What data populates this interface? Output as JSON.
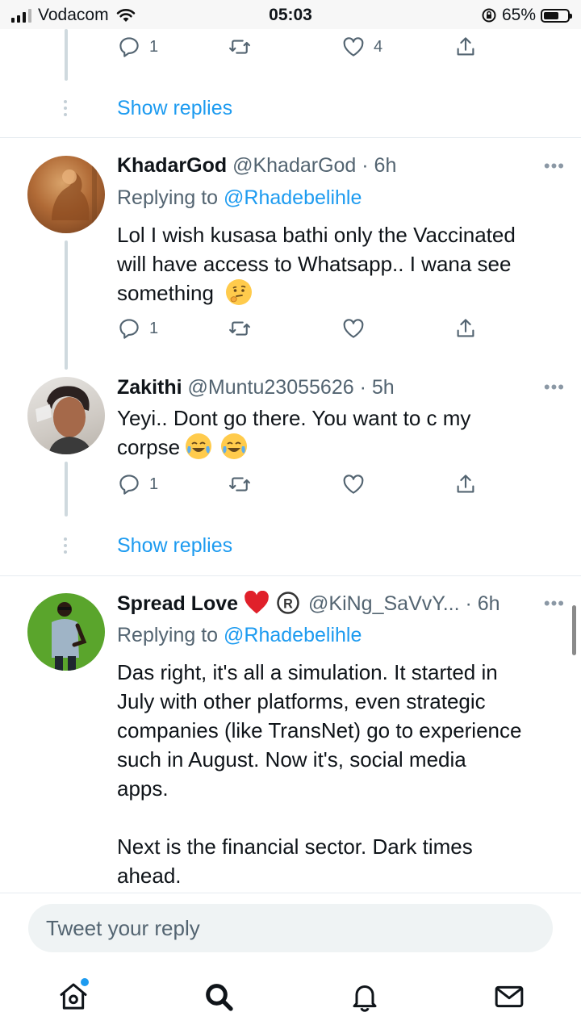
{
  "status_bar": {
    "carrier": "Vodacom",
    "time": "05:03",
    "battery_text": "65%",
    "battery_level": 0.65
  },
  "top_tweet_tail": {
    "reply_count": "1",
    "like_count": "4",
    "show_replies": "Show replies"
  },
  "tweets": [
    {
      "name": "KhadarGod",
      "handle": "@KhadarGod · 6h",
      "replying_label": "Replying to",
      "replying_to": "@Rhadebelihle",
      "text_lines": [
        "Lol I wish kusasa bathi only the Vaccinated",
        "will have access to Whatsapp.. I wana see",
        "something"
      ],
      "emoji": "thinking-face",
      "reply_count": "1"
    },
    {
      "name": "Zakithi",
      "handle": "@Muntu23055626 · 5h",
      "text_lines": [
        "Yeyi.. Dont go there. You want to c my",
        "corpse"
      ],
      "emoji": "tears-of-joy-face",
      "reply_count": "1",
      "show_replies": "Show replies"
    },
    {
      "name": "Spread Love",
      "name_symbols": "❤️ ®",
      "handle": "@KiNg_SaVvY... · 6h",
      "replying_label": "Replying to",
      "replying_to": "@Rhadebelihle",
      "text_lines": [
        "Das right, it's all a simulation. It started in",
        "July with other platforms, even strategic",
        "companies (like TransNet) go to experience",
        "such in August. Now it's, social media",
        "apps."
      ],
      "text_lines_2": [
        "Next is the financial sector. Dark times",
        "ahead."
      ]
    }
  ],
  "compose": {
    "placeholder": "Tweet your reply"
  },
  "tabbar": {
    "items": [
      "home-icon",
      "search-icon",
      "notifications-icon",
      "messages-icon"
    ]
  },
  "colors": {
    "link": "#1d9bf0",
    "secondary_text": "#536471",
    "thread_line": "#cfd9de"
  }
}
